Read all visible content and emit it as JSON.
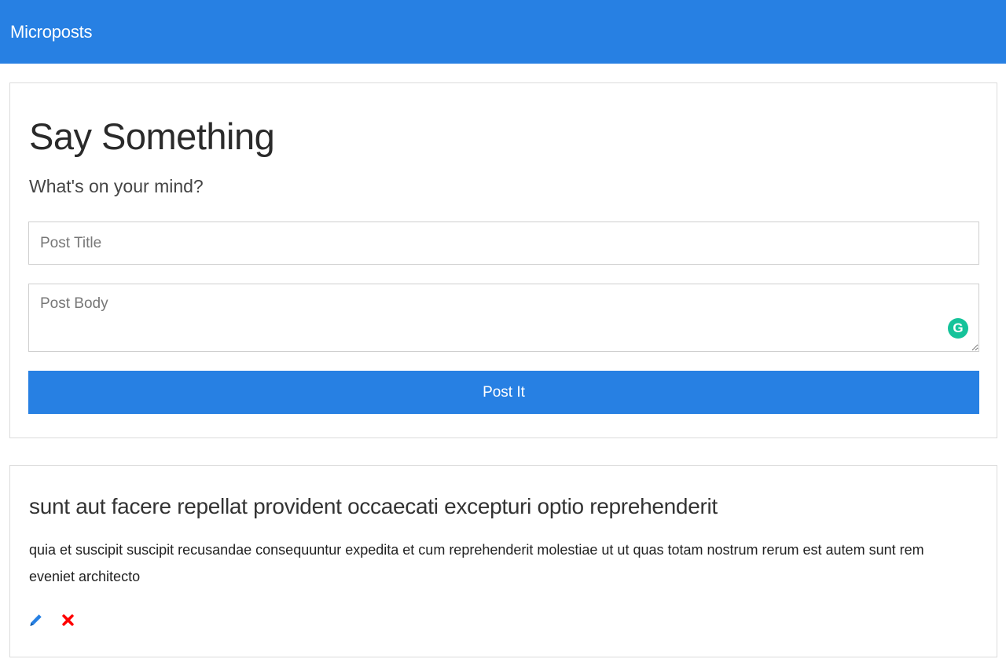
{
  "navbar": {
    "brand": "Microposts",
    "color": "#2780e3"
  },
  "form": {
    "heading": "Say Something",
    "subheading": "What's on your mind?",
    "title_placeholder": "Post Title",
    "body_placeholder": "Post Body",
    "submit_label": "Post It",
    "grammarly_badge": "G"
  },
  "posts": [
    {
      "title": "sunt aut facere repellat provident occaecati excepturi optio reprehenderit",
      "body": "quia et suscipit suscipit recusandae consequuntur expedita et cum reprehenderit molestiae ut ut quas totam nostrum rerum est autem sunt rem eveniet architecto",
      "edit_icon": "pencil-icon",
      "delete_icon": "remove-icon",
      "edit_color": "#2780e3",
      "delete_color": "#ff0000"
    }
  ]
}
